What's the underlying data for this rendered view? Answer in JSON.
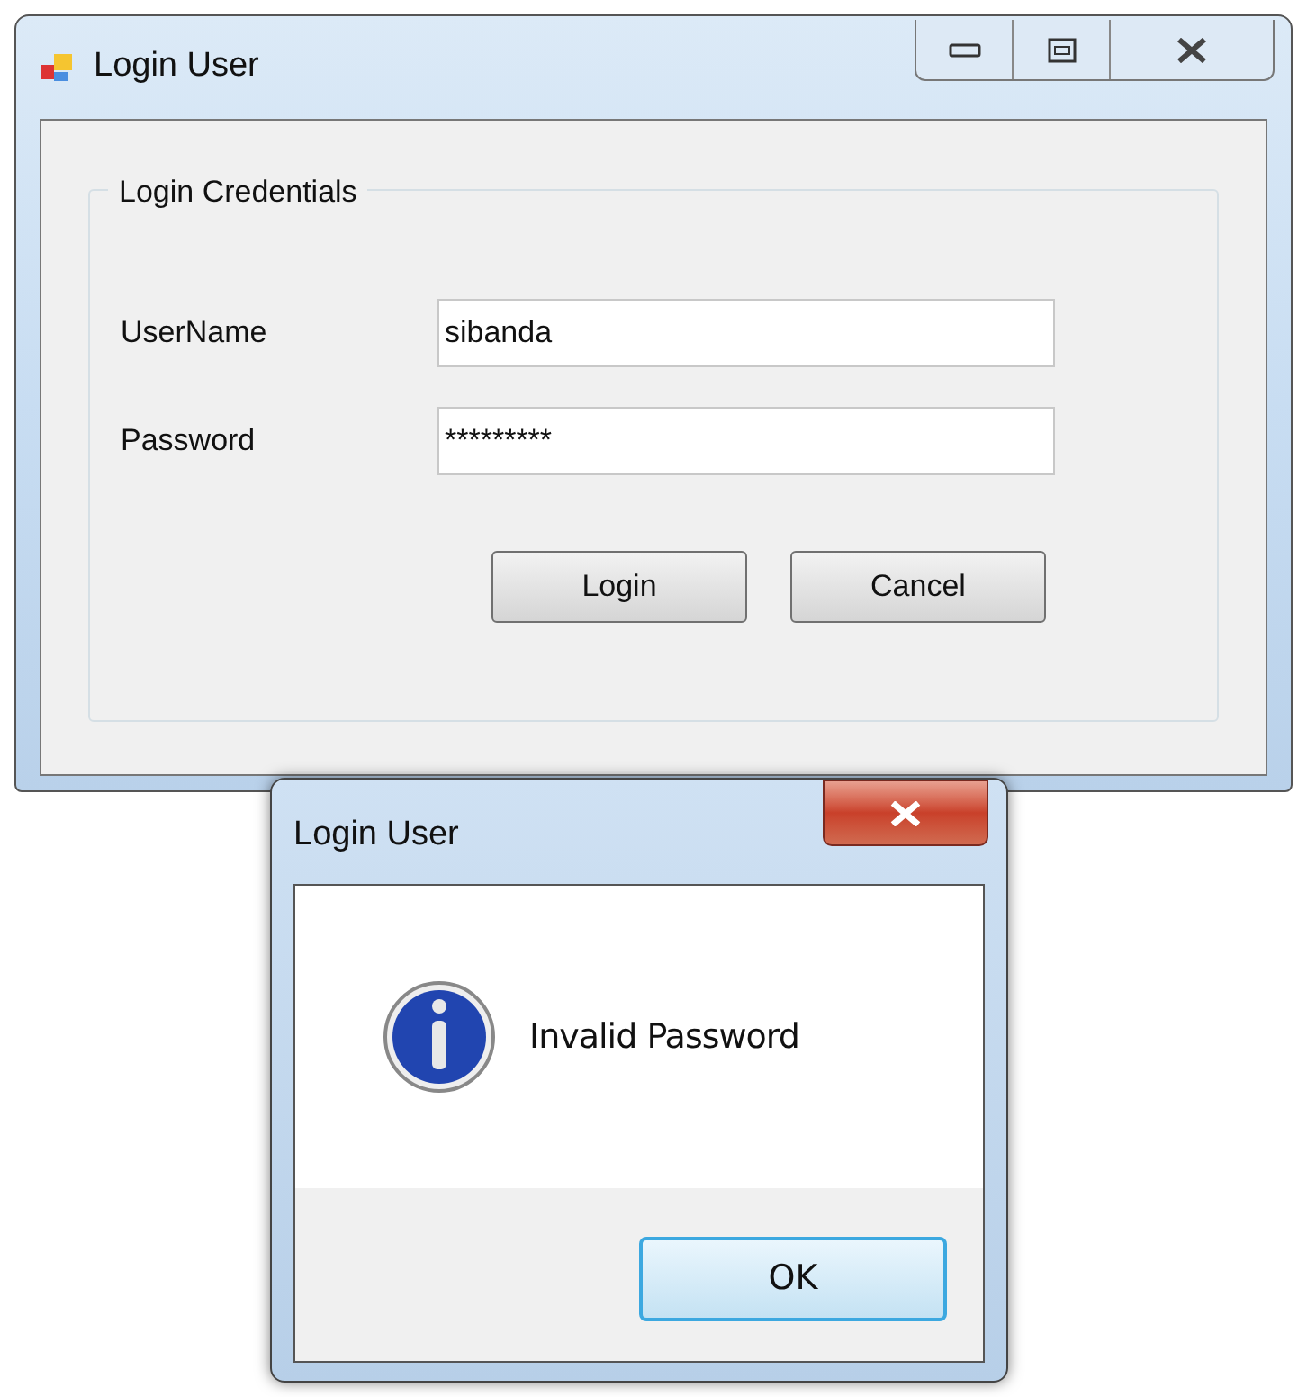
{
  "window": {
    "title": "Login User"
  },
  "group": {
    "title": "Login Credentials"
  },
  "fields": [
    {
      "label": "UserName",
      "value": "sibanda"
    },
    {
      "label": "Password",
      "value": "*********"
    }
  ],
  "buttons": [
    "Login",
    "Cancel"
  ],
  "dialog": {
    "title": "Login User",
    "message": "Invalid Password",
    "button": "OK"
  }
}
